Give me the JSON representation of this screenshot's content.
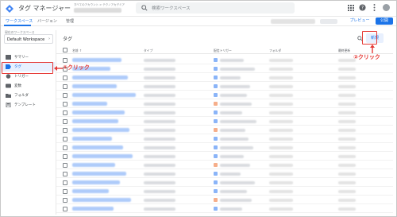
{
  "header": {
    "app_title": "タグ マネージャー",
    "account_label": "すべてのアカウント > テクノアカデミア",
    "search_placeholder": "検索ワークスペース"
  },
  "tabbar": {
    "tabs": [
      {
        "label": "ワークスペース",
        "active": true
      },
      {
        "label": "バージョン",
        "active": false
      },
      {
        "label": "管理",
        "active": false
      }
    ],
    "preview_label": "プレビュー",
    "publish_label": "公開"
  },
  "sidebar": {
    "workspace_label": "現在のワークスペース",
    "workspace_name": "Default Workspace",
    "items": [
      {
        "label": "サマリー",
        "icon": "summary-icon",
        "active": false
      },
      {
        "label": "タグ",
        "icon": "tag-icon",
        "active": true
      },
      {
        "label": "トリガー",
        "icon": "trigger-icon",
        "active": false
      },
      {
        "label": "変数",
        "icon": "variable-icon",
        "active": false
      },
      {
        "label": "フォルダ",
        "icon": "folder-icon",
        "active": false
      },
      {
        "label": "テンプレート",
        "icon": "template-icon",
        "active": false
      }
    ]
  },
  "main": {
    "title": "タグ",
    "new_button": "新規",
    "columns": [
      "名前",
      "タイプ",
      "配信トリガー",
      "フォルダ",
      "最終更新"
    ],
    "rows": [
      {
        "trigger_color": "#8ab4f8"
      },
      {
        "trigger_color": "#8ab4f8"
      },
      {
        "trigger_color": "#8ab4f8"
      },
      {
        "trigger_color": "#8ab4f8"
      },
      {
        "trigger_color": "#8ab4f8"
      },
      {
        "trigger_color": "#f6ae8a"
      },
      {
        "trigger_color": "#8ab4f8"
      },
      {
        "trigger_color": "#8ab4f8"
      },
      {
        "trigger_color": "#f6ae8a"
      },
      {
        "trigger_color": "#8ab4f8"
      },
      {
        "trigger_color": "#8ab4f8"
      },
      {
        "trigger_color": "#8ab4f8"
      },
      {
        "trigger_color": "#f6ae8a"
      },
      {
        "trigger_color": "#8ab4f8"
      },
      {
        "trigger_color": "#8ab4f8"
      },
      {
        "trigger_color": "#8ab4f8"
      },
      {
        "trigger_color": "#f6ae8a"
      },
      {
        "trigger_color": "#8ab4f8"
      }
    ]
  },
  "annotations": {
    "step1": "①クリック",
    "step2": "②クリック"
  },
  "colors": {
    "accent": "#1a73e8",
    "highlight": "#e53935"
  }
}
